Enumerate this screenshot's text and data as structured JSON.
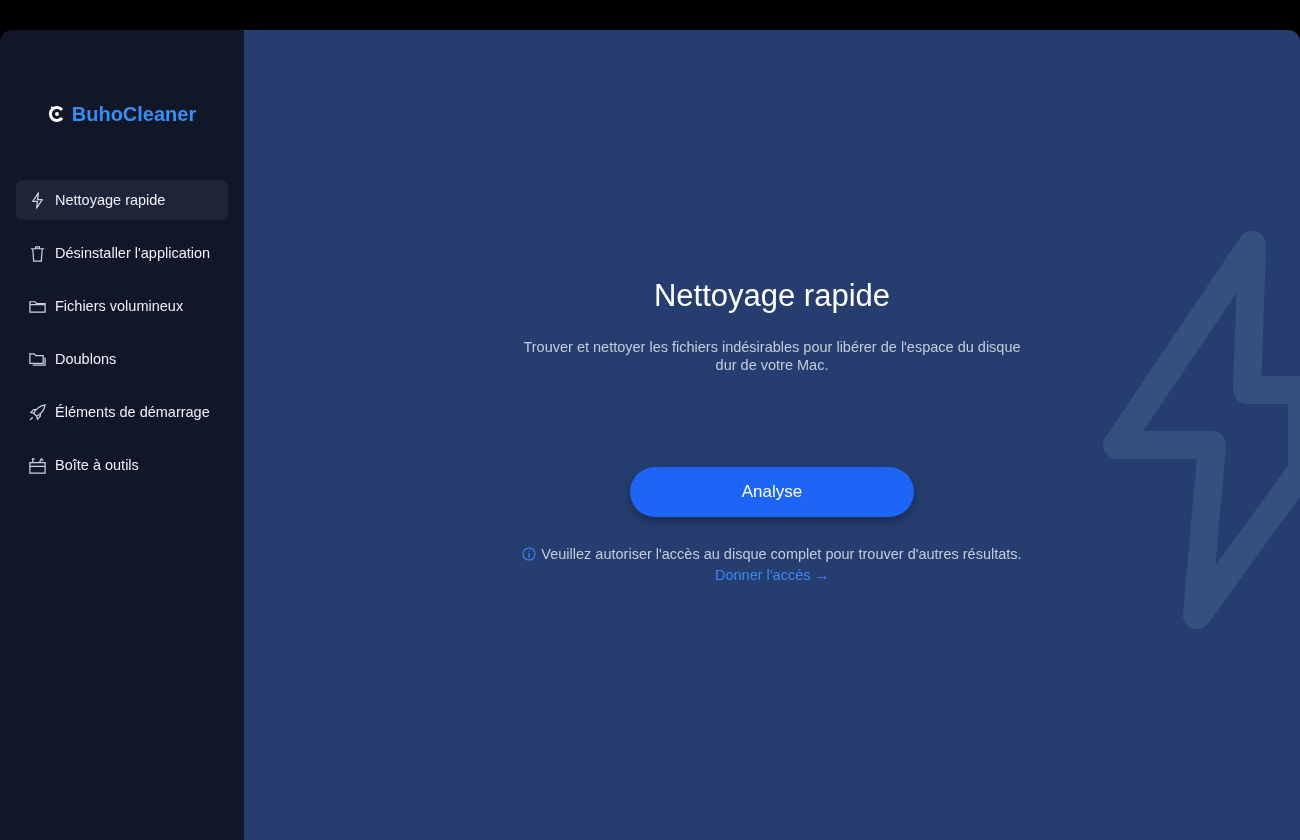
{
  "app": {
    "name": "BuhoCleaner"
  },
  "sidebar": {
    "items": [
      {
        "label": "Nettoyage rapide",
        "kind": "bolt",
        "selected": true
      },
      {
        "label": "Désinstaller l'application",
        "kind": "trash",
        "selected": false
      },
      {
        "label": "Fichiers volumineux",
        "kind": "folder",
        "selected": false
      },
      {
        "label": "Doublons",
        "kind": "folders",
        "selected": false
      },
      {
        "label": "Éléments de démarrage",
        "kind": "rocket",
        "selected": false
      },
      {
        "label": "Boîte à outils",
        "kind": "toolbox",
        "selected": false
      }
    ]
  },
  "main": {
    "title": "Nettoyage rapide",
    "description": "Trouver et nettoyer les fichiers indésirables pour libérer de l'espace du disque dur de votre Mac.",
    "button": "Analyse",
    "notice": "Veuillez autoriser l'accès au disque complet pour trouver d'autres résultats.",
    "link": "Donner l'accès →"
  }
}
